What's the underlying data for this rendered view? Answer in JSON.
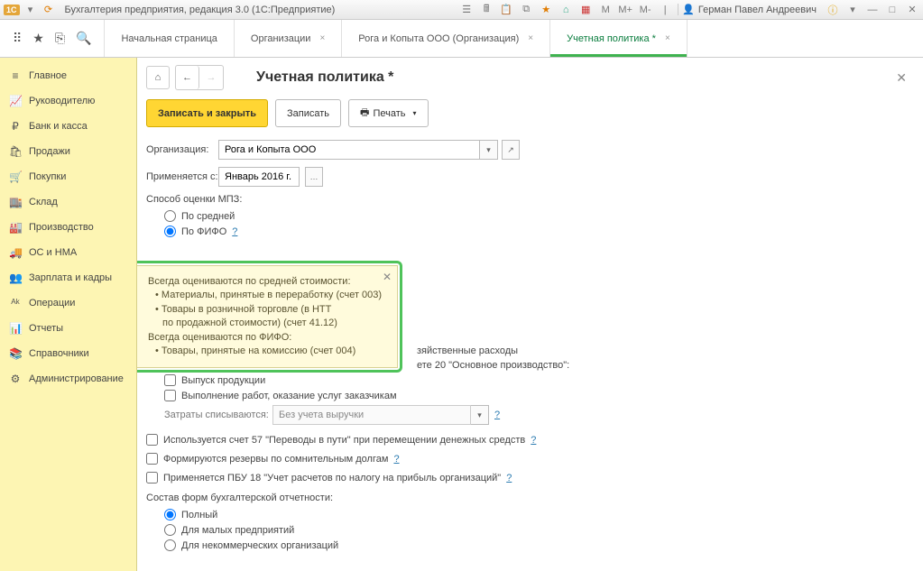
{
  "titlebar": {
    "app_badge": "1C",
    "title": "Бухгалтерия предприятия, редакция 3.0 (1С:Предприятие)",
    "user": "Герман Павел Андреевич",
    "m_buttons": [
      "M",
      "M+",
      "M-"
    ],
    "win_min": "—",
    "win_max": "□",
    "win_close": "✕"
  },
  "toolbar": {
    "icons": {
      "grid": "⠿",
      "star": "★",
      "copy": "⎘",
      "search": "🔍"
    }
  },
  "tabs": [
    {
      "label": "Начальная страница",
      "closable": false
    },
    {
      "label": "Организации",
      "closable": true
    },
    {
      "label": "Рога и Копыта ООО (Организация)",
      "closable": true
    },
    {
      "label": "Учетная политика *",
      "closable": true,
      "active": true
    }
  ],
  "sidebar": [
    {
      "icon": "≡",
      "label": "Главное"
    },
    {
      "icon": "📈",
      "label": "Руководителю"
    },
    {
      "icon": "₽",
      "label": "Банк и касса"
    },
    {
      "icon": "🛍",
      "label": "Продажи"
    },
    {
      "icon": "🛒",
      "label": "Покупки"
    },
    {
      "icon": "🏬",
      "label": "Склад"
    },
    {
      "icon": "🏭",
      "label": "Производство"
    },
    {
      "icon": "🚚",
      "label": "ОС и НМА"
    },
    {
      "icon": "👥",
      "label": "Зарплата и кадры"
    },
    {
      "icon": "ᴬᵏ",
      "label": "Операции"
    },
    {
      "icon": "📊",
      "label": "Отчеты"
    },
    {
      "icon": "📚",
      "label": "Справочники"
    },
    {
      "icon": "⚙",
      "label": "Администрирование"
    }
  ],
  "page": {
    "title": "Учетная политика *",
    "nav": {
      "home": "⌂",
      "back": "←",
      "fwd": "→"
    },
    "buttons": {
      "save_close": "Записать и закрыть",
      "save": "Записать",
      "print": "Печать"
    },
    "close": "✕"
  },
  "form": {
    "org_label": "Организация:",
    "org_value": "Рога и Копыта ООО",
    "applied_label": "Применяется с:",
    "applied_value": "Январь 2016 г.",
    "mpz_label": "Способ оценки МПЗ:",
    "mpz_opt1": "По средней",
    "mpz_opt2": "По ФИФО",
    "help": "?",
    "partial_expense": "зяйственные расходы",
    "partial_account": "ете 20 \"Основное производство\":",
    "chk_output": "Выпуск продукции",
    "chk_services": "Выполнение работ, оказание услуг заказчикам",
    "costs_label": "Затраты списываются:",
    "costs_value": "Без учета выручки",
    "chk_57": "Используется счет 57 \"Переводы в пути\" при перемещении денежных средств",
    "chk_reserves": "Формируются резервы по сомнительным долгам",
    "chk_pbu18": "Применяется ПБУ 18 \"Учет расчетов по налогу на прибыль организаций\"",
    "report_label": "Состав форм бухгалтерской отчетности:",
    "rep_opt1": "Полный",
    "rep_opt2": "Для малых предприятий",
    "rep_opt3": "Для некоммерческих организаций"
  },
  "tooltip": {
    "l1": "Всегда оцениваются по средней стоимости:",
    "l2": "• Материалы, принятые в переработку (счет 003)",
    "l3": "• Товары в розничной торговле (в НТТ",
    "l4": "по продажной стоимости) (счет 41.12)",
    "l5": "Всегда оцениваются по ФИФО:",
    "l6": "• Товары, принятые на комиссию (счет 004)",
    "close": "✕"
  }
}
